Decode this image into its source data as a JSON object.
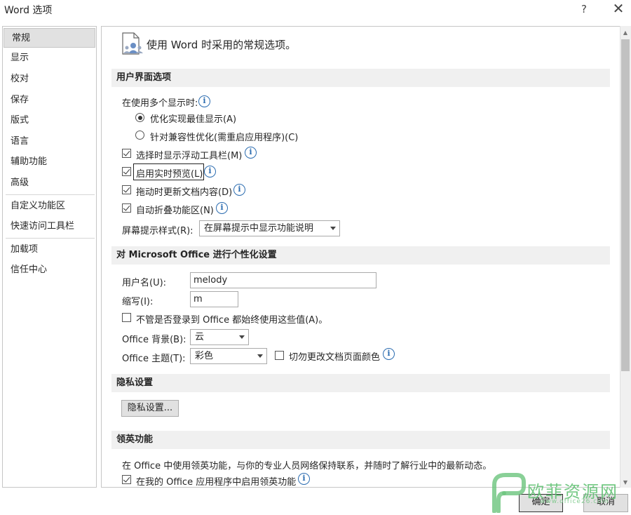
{
  "window": {
    "title": "Word 选项",
    "help_glyph": "?",
    "close_glyph": "✕"
  },
  "sidebar": {
    "items": [
      {
        "label": "常规",
        "selected": true
      },
      {
        "label": "显示"
      },
      {
        "label": "校对"
      },
      {
        "label": "保存"
      },
      {
        "label": "版式"
      },
      {
        "label": "语言"
      },
      {
        "label": "辅助功能"
      },
      {
        "label": "高级"
      },
      {
        "label": "自定义功能区"
      },
      {
        "label": "快速访问工具栏"
      },
      {
        "label": "加载项"
      },
      {
        "label": "信任中心"
      }
    ]
  },
  "header": {
    "icon": "general-options-icon",
    "text": "使用 Word 时采用的常规选项。"
  },
  "ui_options": {
    "section_title": "用户界面选项",
    "multi_display_label": "在使用多个显示时:",
    "radio_best_label": "优化实现最佳显示(A)",
    "radio_compat_label": "针对兼容性优化(需重启应用程序)(C)",
    "mini_toolbar_label": "选择时显示浮动工具栏(M)",
    "live_preview_label": "启用实时预览(L)",
    "update_drag_label": "拖动时更新文档内容(D)",
    "collapse_ribbon_label": "自动折叠功能区(N)",
    "screentip_label": "屏幕提示样式(R):",
    "screentip_value": "在屏幕提示中显示功能说明"
  },
  "personalize": {
    "section_title": "对 Microsoft Office 进行个性化设置",
    "username_label": "用户名(U):",
    "username_value": "melody",
    "initials_label": "缩写(I):",
    "initials_value": "m",
    "always_use_label": "不管是否登录到 Office 都始终使用这些值(A)。",
    "background_label": "Office 背景(B):",
    "background_value": "云",
    "theme_label": "Office 主题(T):",
    "theme_value": "彩色",
    "no_change_color_label": "切勿更改文档页面颜色"
  },
  "privacy": {
    "section_title": "隐私设置",
    "button_label": "隐私设置..."
  },
  "linkedin": {
    "section_title": "领英功能",
    "description": "在 Office 中使用领英功能，与你的专业人员网络保持联系，并随时了解行业中的最新动态。",
    "enable_label": "在我的 Office 应用程序中启用领英功能"
  },
  "footer": {
    "ok_label": "确定",
    "cancel_label": "取消"
  },
  "info_glyph": "i",
  "watermark": {
    "text": "欧菲资源网",
    "sub": "www.office26.com"
  }
}
